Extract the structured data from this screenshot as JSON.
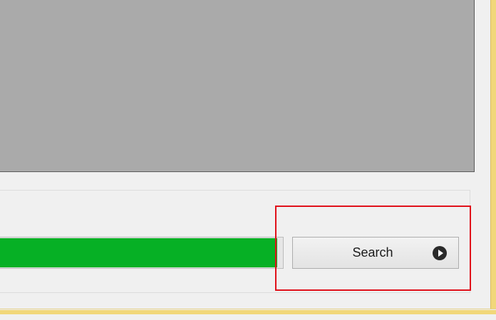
{
  "progress": {
    "level": 0.98
  },
  "search_button": {
    "label": "Search",
    "icon": "play-circle-icon"
  },
  "annotation": {
    "highlight_color": "#e0101a"
  },
  "colors": {
    "progress_fill": "#06b025",
    "content_pane": "#aaaaaa",
    "window_accent": "#f1d77a"
  }
}
